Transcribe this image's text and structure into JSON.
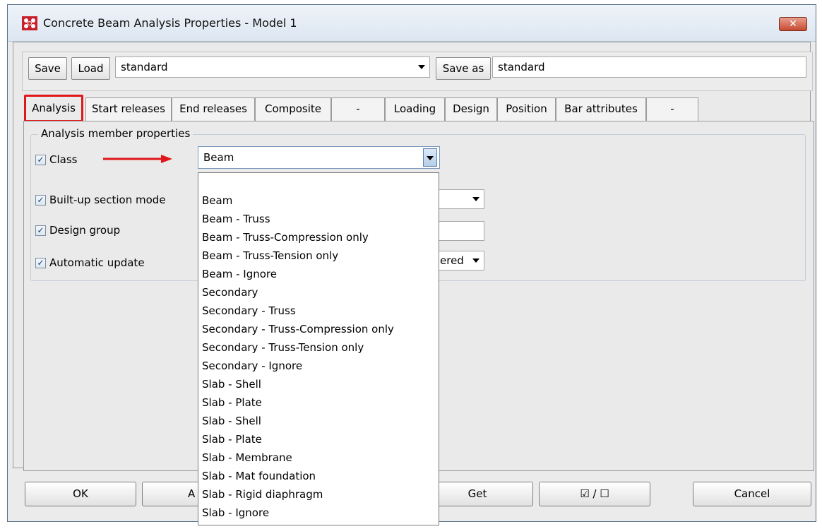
{
  "window": {
    "title": "Concrete Beam Analysis Properties - Model 1",
    "close_glyph": "✕",
    "icon": "app-logo-icon"
  },
  "toolbar": {
    "save_label": "Save",
    "load_label": "Load",
    "preset_value": "standard",
    "save_as_label": "Save as",
    "save_as_value": "standard"
  },
  "tabs": [
    "Analysis",
    "Start releases",
    "End releases",
    "Composite",
    "-",
    "Loading",
    "Design",
    "Position",
    "Bar attributes",
    "-"
  ],
  "active_tab": "Analysis",
  "group": {
    "title": "Analysis member properties"
  },
  "properties": [
    {
      "label": "Class",
      "checked": true
    },
    {
      "label": "Built-up section mode",
      "checked": true
    },
    {
      "label": "Design group",
      "checked": true
    },
    {
      "label": "Automatic update",
      "checked": true
    }
  ],
  "class_select": {
    "value": "Beam",
    "options": [
      "Beam",
      "Beam - Truss",
      "Beam - Truss-Compression only",
      "Beam - Truss-Tension only",
      "Beam - Ignore",
      "Secondary",
      "Secondary - Truss",
      "Secondary - Truss-Compression only",
      "Secondary - Truss-Tension only",
      "Secondary - Ignore",
      "Slab - Shell",
      "Slab - Plate",
      "Slab - Shell",
      "Slab - Plate",
      "Slab - Membrane",
      "Slab - Mat foundation",
      "Slab - Rigid diaphragm",
      "Slab - Ignore"
    ]
  },
  "auto_update_partial_value": "ered",
  "buttons": {
    "ok": "OK",
    "apply_partial": "A",
    "get": "Get",
    "toggle": "☑ / ☐",
    "cancel": "Cancel"
  },
  "colors": {
    "highlight_red": "#e0161b",
    "annotation_arrow": "#e0161b"
  }
}
